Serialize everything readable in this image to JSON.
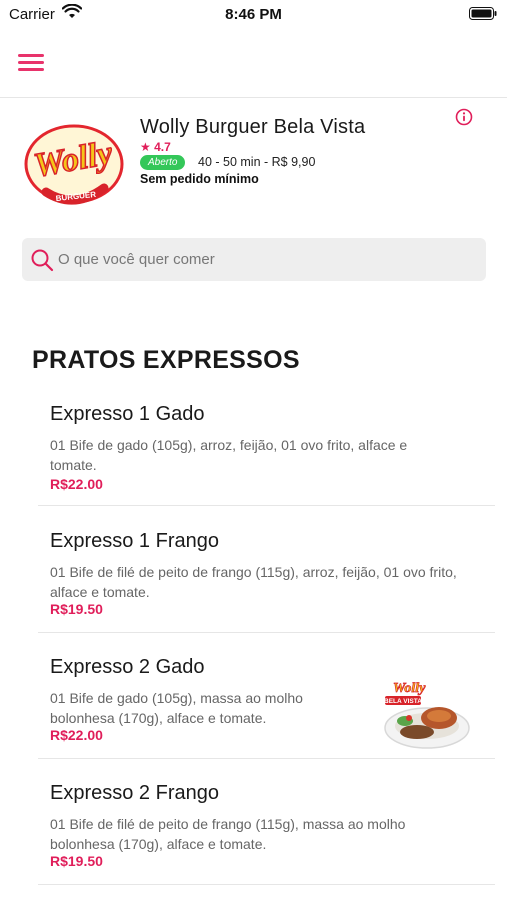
{
  "status_bar": {
    "carrier": "Carrier",
    "time": "8:46 PM"
  },
  "store": {
    "name": "Wolly Burguer Bela Vista",
    "rating": "4.7",
    "status_badge": "Aberto",
    "delivery_info": "40 - 50 min - R$ 9,90",
    "min_order": "Sem pedido mínimo",
    "logo_text": "Wolly",
    "logo_subtext": "BURGUER"
  },
  "search": {
    "placeholder": "O que você quer comer"
  },
  "section": {
    "title": "PRATOS EXPRESSOS"
  },
  "products": [
    {
      "name": "Expresso 1 Gado",
      "description": "01 Bife de gado (105g), arroz, feijão, 01 ovo frito, alface e tomate.",
      "price": "R$22.00"
    },
    {
      "name": "Expresso 1 Frango",
      "description": "01 Bife de filé de peito de frango (115g), arroz, feijão, 01 ovo frito, alface e tomate.",
      "price": "R$19.50"
    },
    {
      "name": "Expresso 2 Gado",
      "description": "01 Bife de gado (105g), massa ao molho bolonhesa (170g), alface e tomate.",
      "price": "R$22.00",
      "image_caption": "BELA VISTA"
    },
    {
      "name": "Expresso 2 Frango",
      "description": "01 Bife de filé de peito de frango (115g), massa ao molho bolonhesa (170g), alface e tomate.",
      "price": "R$19.50"
    }
  ],
  "colors": {
    "accent": "#e01e5a",
    "open_badge": "#34c759",
    "search_bg": "#eeeeee"
  }
}
